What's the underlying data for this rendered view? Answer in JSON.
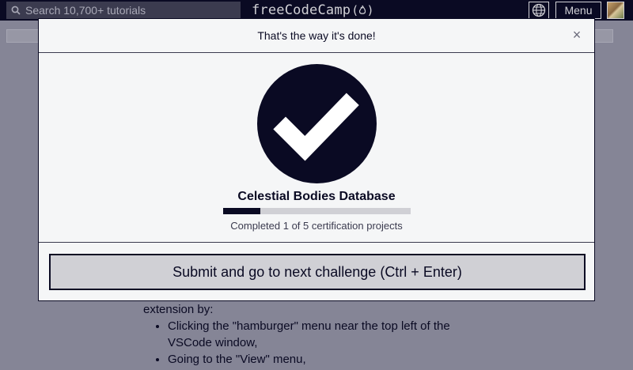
{
  "nav": {
    "search_placeholder": "Search 10,700+ tutorials",
    "brand": "freeCodeCamp",
    "brand_flame": "(🔥)",
    "menu_label": "Menu"
  },
  "modal": {
    "title": "That's the way it's done!",
    "close": "×",
    "project_title": "Celestial Bodies Database",
    "progress": {
      "completed": 1,
      "total": 5,
      "text": "Completed 1 of 5 certification projects"
    },
    "submit_label": "Submit and go to next challenge (Ctrl + Enter)"
  },
  "background": {
    "intro": "extension by:",
    "items": [
      "Clicking the \"hamburger\" menu near the top left of the VSCode window,",
      "Going to the \"View\" menu,"
    ]
  },
  "colors": {
    "nav_bg": "#0a0a23",
    "overlay": "#858596",
    "modal_bg": "#f5f6f7",
    "accent": "#0a0a23",
    "button_bg": "#d0d0d5"
  }
}
